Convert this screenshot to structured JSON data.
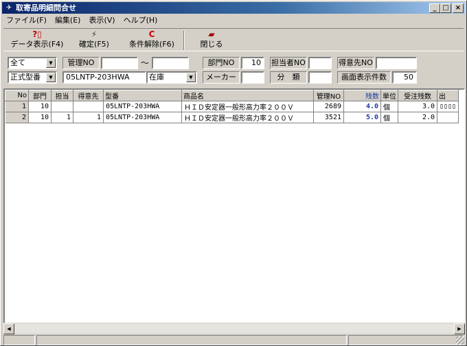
{
  "window": {
    "title": "取寄品明細問合せ"
  },
  "menu": [
    "ファイル(F)",
    "編集(E)",
    "表示(V)",
    "ヘルプ(H)"
  ],
  "toolbar": [
    {
      "label": "データ表示(F4)",
      "icon": "question-icon",
      "glyph": "?▯"
    },
    {
      "label": "確定(F5)",
      "icon": "confirm-icon",
      "glyph": "⚡"
    },
    {
      "label": "条件解除(F6)",
      "icon": "reset-icon",
      "glyph": "C"
    },
    {
      "label": "閉じる",
      "icon": "close-door-icon",
      "glyph": "▰"
    }
  ],
  "filters": {
    "scope": "全て",
    "model_type": "正式型番",
    "kanri_no_label": "管理NO",
    "kanri_from": "",
    "tilde": "～",
    "kanri_to": "",
    "model_no": "05LNTP-203HWA",
    "stock_status": "在庫",
    "bumon_label": "部門NO",
    "bumon_value": "10",
    "maker_label": "メーカー",
    "maker_value": "",
    "tanto_label": "担当者NO",
    "tanto_value": "",
    "bunrui_label": "分　類",
    "bunrui_value": "",
    "tokui_label": "得意先NO",
    "tokui_value": "",
    "count_label": "画面表示件数",
    "count_value": "50"
  },
  "table": {
    "columns": [
      "No",
      "部門",
      "担当",
      "得意先",
      "型番",
      "商品名",
      "管理NO",
      "残数",
      "単位",
      "受注残数",
      "出"
    ],
    "rows": [
      {
        "no": "1",
        "bumon": "10",
        "tanto": "",
        "tokui": "",
        "model": "05LNTP-203HWA",
        "name": "ＨＩＤ安定器一般形高力率２００Ｖ",
        "kanri": "2689",
        "zan": "4.0",
        "unit": "個",
        "juchu": "3.0",
        "out": ""
      },
      {
        "no": "2",
        "bumon": "10",
        "tanto": "1",
        "tokui": "1",
        "model": "05LNTP-203HWA",
        "name": "ＨＩＤ安定器一般形高力率２００Ｖ",
        "kanri": "3521",
        "zan": "5.0",
        "unit": "個",
        "juchu": "2.0",
        "out": ""
      }
    ]
  },
  "colors": {
    "title_start": "#0a246a",
    "title_end": "#a6caf0",
    "highlight_col": "#1a3aa0"
  }
}
